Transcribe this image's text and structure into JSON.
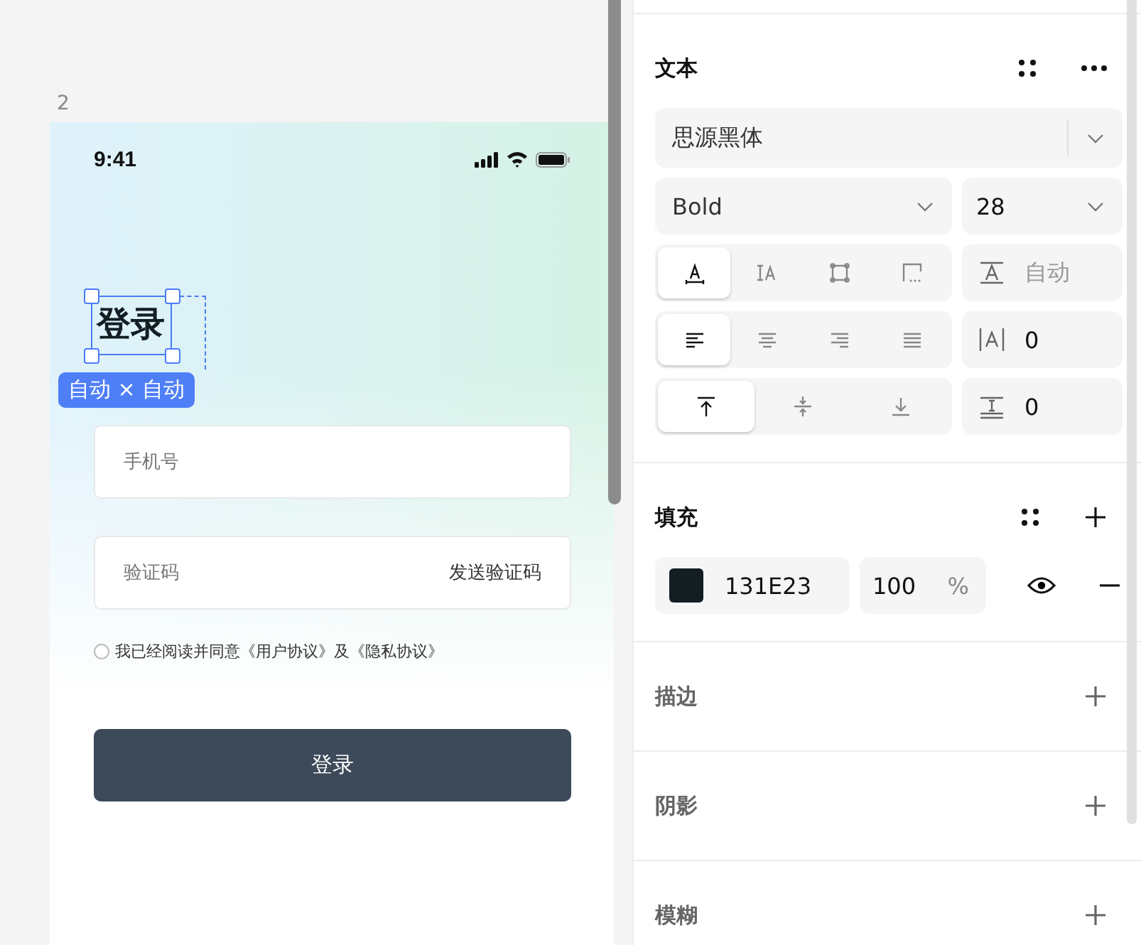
{
  "canvas": {
    "frame_label": "2"
  },
  "phone": {
    "time": "9:41",
    "title": "登录",
    "selection_badge": "自动 × 自动",
    "fields": [
      {
        "placeholder": "手机号"
      },
      {
        "placeholder": "验证码",
        "action": "发送验证码"
      }
    ],
    "agreement": {
      "checked": false,
      "text": "我已经阅读并同意《用户协议》及《隐私协议》"
    },
    "login_button": "登录"
  },
  "text_panel": {
    "title": "文本",
    "font_family": "思源黑体",
    "font_weight": "Bold",
    "font_size": "28",
    "resize_modes": [
      {
        "kind": "autowidth",
        "selected": true
      },
      {
        "kind": "autoheight",
        "selected": false
      },
      {
        "kind": "fixed",
        "selected": false
      },
      {
        "kind": "truncate",
        "selected": false
      }
    ],
    "line_height": {
      "placeholder": "自动"
    },
    "align": [
      {
        "kind": "left",
        "selected": true
      },
      {
        "kind": "center",
        "selected": false
      },
      {
        "kind": "right",
        "selected": false
      },
      {
        "kind": "justify",
        "selected": false
      }
    ],
    "letter_spacing": "0",
    "vertical_align": [
      {
        "kind": "top",
        "selected": true
      },
      {
        "kind": "middle",
        "selected": false
      },
      {
        "kind": "bottom",
        "selected": false
      }
    ],
    "paragraph_spacing": "0"
  },
  "fill_panel": {
    "title": "填充",
    "hex": "131E23",
    "opacity": "100",
    "unit": "%",
    "visible": true
  },
  "collapsed_sections": [
    {
      "title": "描边"
    },
    {
      "title": "阴影"
    },
    {
      "title": "模糊"
    }
  ]
}
